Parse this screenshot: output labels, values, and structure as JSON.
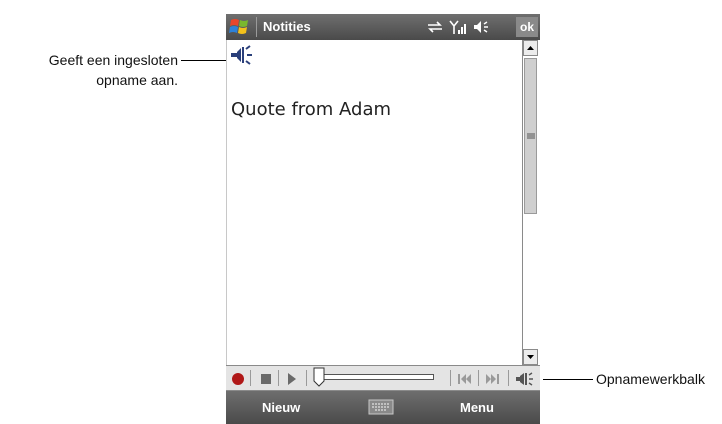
{
  "app": {
    "title": "Notities",
    "ok_label": "ok"
  },
  "status_icons": [
    "sync-icon",
    "signal-icon",
    "volume-icon"
  ],
  "note": {
    "text": "Quote from Adam"
  },
  "recording_toolbar": {
    "buttons": [
      "record-icon",
      "stop-icon",
      "play-icon",
      "skip-back-icon",
      "skip-forward-icon",
      "speaker-icon"
    ]
  },
  "menubar": {
    "left_label": "Nieuw",
    "right_label": "Menu"
  },
  "callouts": {
    "embedded_line1": "Geeft een ingesloten",
    "embedded_line2": "opname aan.",
    "toolbar": "Opnamewerkbalk"
  },
  "colors": {
    "title_bar": "#4a4a4a",
    "record_red": "#b01818",
    "icon_blue": "#2a3f7a"
  }
}
